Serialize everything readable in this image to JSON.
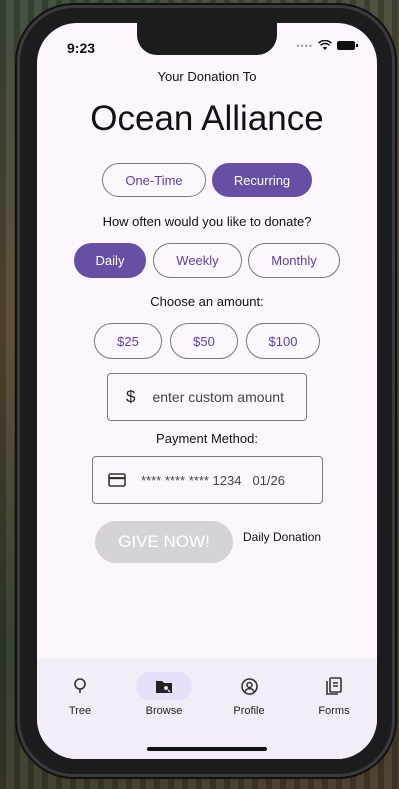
{
  "status": {
    "time": "9:23"
  },
  "header": {
    "subtitle": "Your Donation To",
    "org_name": "Ocean Alliance"
  },
  "donation_type": {
    "options": [
      "One-Time",
      "Recurring"
    ],
    "selected": "Recurring"
  },
  "frequency": {
    "question": "How often would you like to donate?",
    "options": [
      "Daily",
      "Weekly",
      "Monthly"
    ],
    "selected": "Daily"
  },
  "amount": {
    "label": "Choose an amount:",
    "options": [
      "$25",
      "$50",
      "$100"
    ],
    "currency_symbol": "$",
    "custom_placeholder": "enter custom amount"
  },
  "payment": {
    "label": "Payment Method:",
    "card_number": "**** **** **** 1234",
    "expiry": "01/26"
  },
  "action": {
    "give_label": "GIVE NOW!",
    "summary": "Daily Donation"
  },
  "nav": {
    "items": [
      {
        "label": "Tree",
        "icon": "tree-icon"
      },
      {
        "label": "Browse",
        "icon": "folder-search-icon"
      },
      {
        "label": "Profile",
        "icon": "account-circle-icon"
      },
      {
        "label": "Forms",
        "icon": "document-icon"
      }
    ],
    "selected": "Browse"
  },
  "colors": {
    "primary": "#6750a4",
    "surface": "#fdf7fd",
    "nav_bg": "#f3edf7",
    "disabled": "#d5d3d8"
  }
}
